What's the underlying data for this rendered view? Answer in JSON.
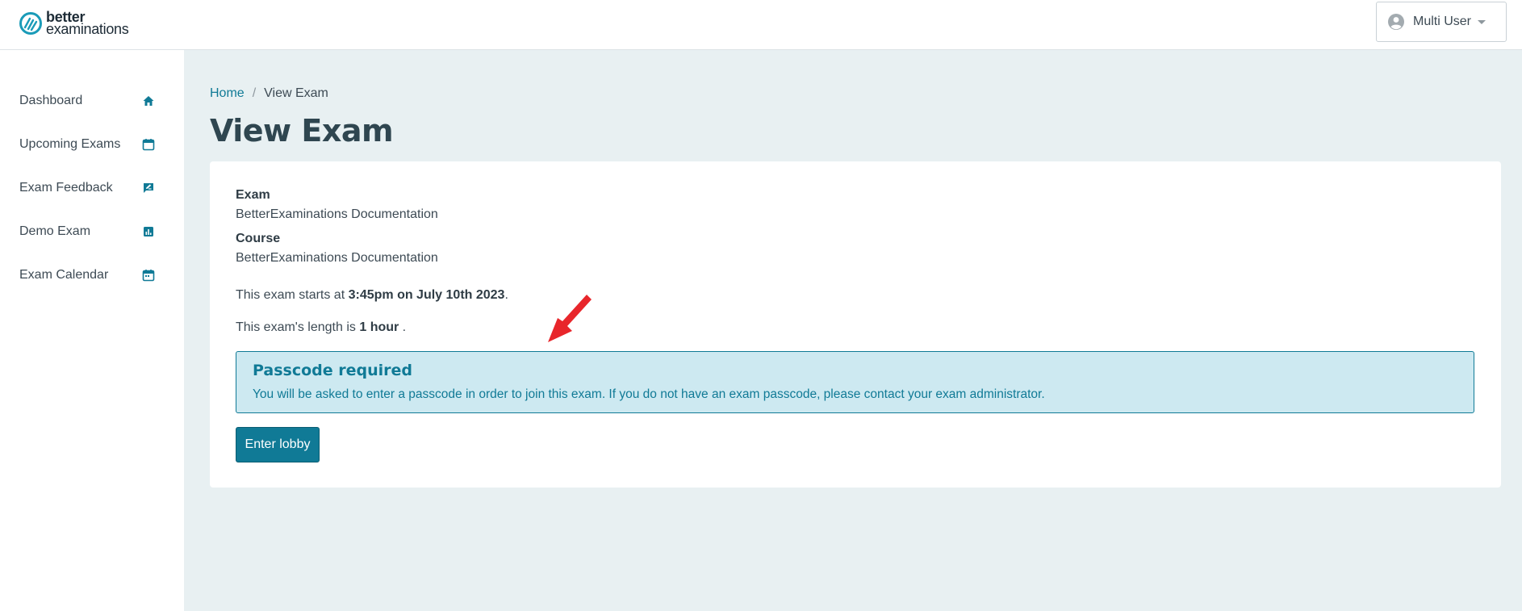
{
  "header": {
    "logo_line1": "better",
    "logo_line2": "examinations",
    "user_label": "Multi User"
  },
  "sidebar": {
    "items": [
      {
        "label": "Dashboard",
        "icon": "home-icon"
      },
      {
        "label": "Upcoming Exams",
        "icon": "calendar-icon"
      },
      {
        "label": "Exam Feedback",
        "icon": "feedback-icon"
      },
      {
        "label": "Demo Exam",
        "icon": "chart-icon"
      },
      {
        "label": "Exam Calendar",
        "icon": "calendar-icon"
      }
    ]
  },
  "breadcrumb": {
    "home": "Home",
    "separator": "/",
    "current": "View Exam"
  },
  "page": {
    "title": "View Exam"
  },
  "exam": {
    "exam_label": "Exam",
    "exam_value": "BetterExaminations Documentation",
    "course_label": "Course",
    "course_value": "BetterExaminations Documentation",
    "start_prefix": "This exam starts at ",
    "start_value": "3:45pm on July 10th 2023",
    "start_suffix": ".",
    "length_prefix": "This exam's length is ",
    "length_value": "1 hour",
    "length_suffix": " ."
  },
  "alert": {
    "title": "Passcode required",
    "text": "You will be asked to enter a passcode in order to join this exam. If you do not have an exam passcode, please contact your exam administrator."
  },
  "actions": {
    "enter_lobby": "Enter lobby"
  },
  "colors": {
    "accent": "#107a96",
    "alert_bg": "#cde9f1",
    "page_bg": "#e8f0f2",
    "annotation_arrow": "#e8262b"
  }
}
